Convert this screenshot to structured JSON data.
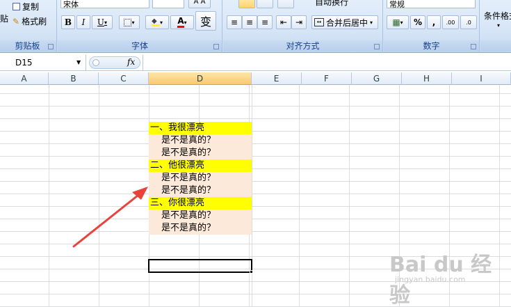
{
  "ribbon": {
    "clipboard": {
      "paste_partial": "贴",
      "copy_label": "复制",
      "format_painter_label": "格式刷",
      "group_label": "剪贴板"
    },
    "font": {
      "font_name": "宋体",
      "bold": "B",
      "italic": "I",
      "underline": "U",
      "font_color_glyph": "A",
      "phonetic_glyph": "变",
      "group_label": "字体"
    },
    "alignment": {
      "merge_center_label": "合并后居中",
      "wrap_text_partial": "自动换行",
      "group_label": "对齐方式"
    },
    "number": {
      "format_value": "常规",
      "percent": "%",
      "comma": ",",
      "inc_decimal": ".00",
      "dec_decimal": ".0",
      "group_label": "数字"
    },
    "styles": {
      "conditional_format_partial": "条件格式"
    }
  },
  "formula_bar": {
    "name_box": "D15",
    "fx_label": "fx",
    "formula": ""
  },
  "columns": [
    "A",
    "B",
    "C",
    "D",
    "E",
    "F",
    "G",
    "H",
    "I"
  ],
  "cells": [
    {
      "text": "一、我很漂亮",
      "style": "yellow"
    },
    {
      "text": "是不是真的？",
      "style": "peach"
    },
    {
      "text": "是不是真的？",
      "style": "peach"
    },
    {
      "text": "二、他很漂亮",
      "style": "yellow"
    },
    {
      "text": "是不是真的？",
      "style": "peach"
    },
    {
      "text": "是不是真的？",
      "style": "peach"
    },
    {
      "text": "三、你很漂亮",
      "style": "yellow"
    },
    {
      "text": "是不是真的？",
      "style": "peach"
    },
    {
      "text": "是不是真的？",
      "style": "peach"
    }
  ],
  "watermark": {
    "brand": "Bai du 经验",
    "url": "jingyan.baidu.com"
  },
  "colors": {
    "header_fill": "#ffff00",
    "item_fill": "#fde9d9",
    "arrow": "#e8423b"
  }
}
